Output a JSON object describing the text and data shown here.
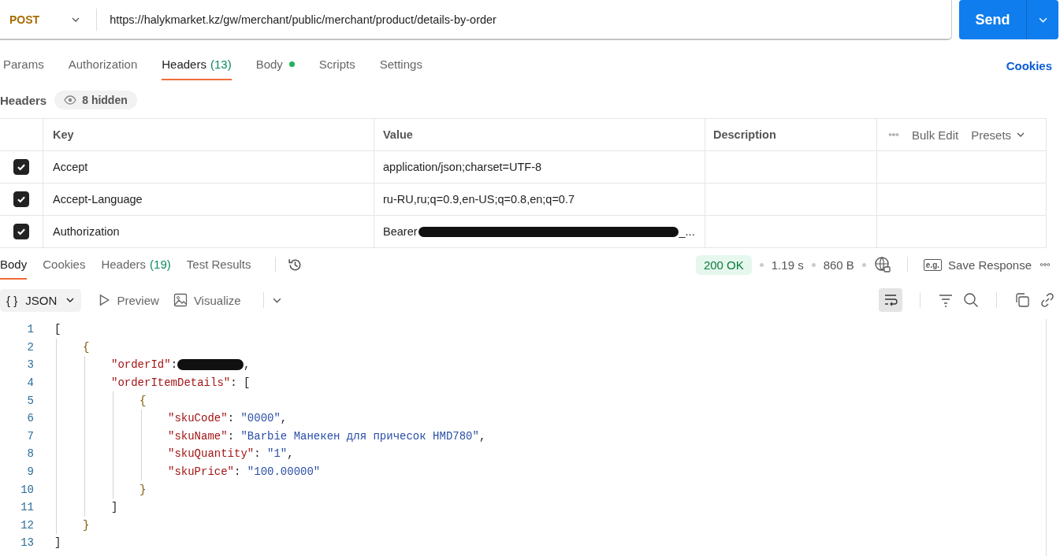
{
  "request": {
    "method": "POST",
    "url": "https://halykmarket.kz/gw/merchant/public/merchant/product/details-by-order",
    "send_label": "Send"
  },
  "request_tabs": [
    {
      "label": "Params",
      "selected": false
    },
    {
      "label": "Authorization",
      "selected": false
    },
    {
      "label": "Headers",
      "count": "(13)",
      "selected": true
    },
    {
      "label": "Body",
      "dot": true,
      "selected": false
    },
    {
      "label": "Scripts",
      "selected": false
    },
    {
      "label": "Settings",
      "selected": false
    }
  ],
  "cookies_link": "Cookies",
  "headers_bar": {
    "title": "Headers",
    "hidden_label": "8 hidden"
  },
  "headers_table": {
    "columns": [
      "Key",
      "Value",
      "Description"
    ],
    "bulk_edit": "Bulk Edit",
    "presets": "Presets",
    "rows": [
      {
        "checked": true,
        "key": "Accept",
        "value": "application/json;charset=UTF-8",
        "redacted": false
      },
      {
        "checked": true,
        "key": "Accept-Language",
        "value": "ru-RU,ru;q=0.9,en-US;q=0.8,en;q=0.7",
        "redacted": false
      },
      {
        "checked": true,
        "key": "Authorization",
        "value": "Bearer",
        "redacted": true,
        "tail": "_..."
      }
    ]
  },
  "response_tabs": [
    {
      "label": "Body",
      "selected": true
    },
    {
      "label": "Cookies",
      "selected": false
    },
    {
      "label": "Headers",
      "count": "(19)",
      "selected": false
    },
    {
      "label": "Test Results",
      "selected": false
    }
  ],
  "response_status": {
    "status": "200 OK",
    "time": "1.19 s",
    "size": "860 B",
    "save_label": "Save Response",
    "badge": "e.g."
  },
  "view_bar": {
    "format": "JSON",
    "format_icon": "{ }",
    "preview": "Preview",
    "visualize": "Visualize",
    "wrap_on": true
  },
  "code": [
    {
      "number": "1",
      "tokens": [
        {
          "kind": "punct",
          "text": "["
        }
      ],
      "children": [
        {
          "number": "2",
          "tokens": [
            {
              "kind": "brace",
              "text": "{"
            }
          ],
          "children": [
            {
              "number": "3",
              "tokens": [
                {
                  "kind": "key",
                  "text": "\"orderId\""
                },
                {
                  "kind": "punct",
                  "text": ":"
                },
                {
                  "kind": "redacted"
                },
                {
                  "kind": "punct",
                  "text": ","
                }
              ]
            },
            {
              "number": "4",
              "tokens": [
                {
                  "kind": "key",
                  "text": "\"orderItemDetails\""
                },
                {
                  "kind": "punct",
                  "text": ": ["
                }
              ],
              "children": [
                {
                  "number": "5",
                  "tokens": [
                    {
                      "kind": "brace",
                      "text": "{"
                    }
                  ],
                  "children": [
                    {
                      "number": "6",
                      "tokens": [
                        {
                          "kind": "key",
                          "text": "\"skuCode\""
                        },
                        {
                          "kind": "punct",
                          "text": ": "
                        },
                        {
                          "kind": "string",
                          "text": "\"0000\""
                        },
                        {
                          "kind": "punct",
                          "text": ","
                        }
                      ]
                    },
                    {
                      "number": "7",
                      "tokens": [
                        {
                          "kind": "key",
                          "text": "\"skuName\""
                        },
                        {
                          "kind": "punct",
                          "text": ": "
                        },
                        {
                          "kind": "string",
                          "text": "\"Barbie Манекен для причесок HMD780\""
                        },
                        {
                          "kind": "punct",
                          "text": ","
                        }
                      ]
                    },
                    {
                      "number": "8",
                      "tokens": [
                        {
                          "kind": "key",
                          "text": "\"skuQuantity\""
                        },
                        {
                          "kind": "punct",
                          "text": ": "
                        },
                        {
                          "kind": "string",
                          "text": "\"1\""
                        },
                        {
                          "kind": "punct",
                          "text": ","
                        }
                      ]
                    },
                    {
                      "number": "9",
                      "tokens": [
                        {
                          "kind": "key",
                          "text": "\"skuPrice\""
                        },
                        {
                          "kind": "punct",
                          "text": ": "
                        },
                        {
                          "kind": "string",
                          "text": "\"100.00000\""
                        }
                      ]
                    }
                  ]
                },
                {
                  "number": "10",
                  "tokens": [
                    {
                      "kind": "brace",
                      "text": "}"
                    }
                  ]
                }
              ]
            },
            {
              "number": "11",
              "tokens": [
                {
                  "kind": "punct",
                  "text": "]"
                }
              ]
            }
          ]
        },
        {
          "number": "12",
          "tokens": [
            {
              "kind": "brace",
              "text": "}"
            }
          ]
        }
      ]
    },
    {
      "number": "13",
      "tokens": [
        {
          "kind": "punct",
          "text": "]"
        }
      ]
    }
  ]
}
